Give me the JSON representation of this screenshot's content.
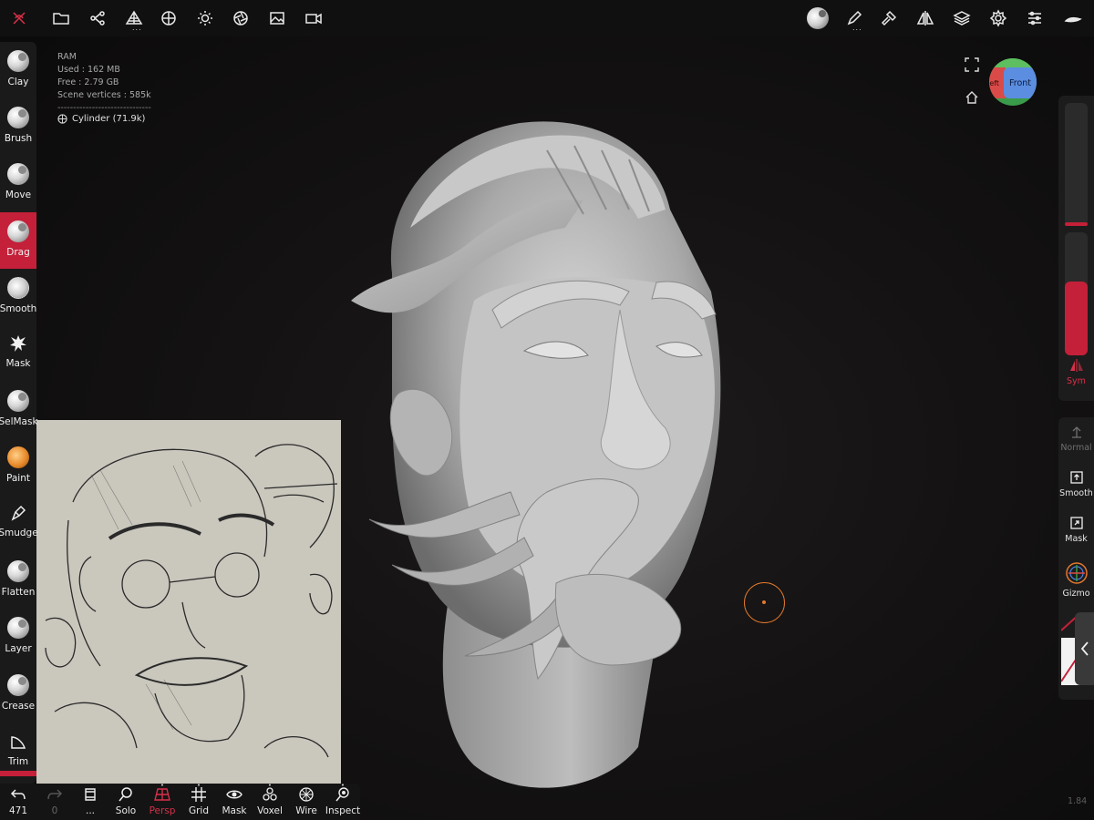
{
  "stats": {
    "ram_label": "RAM",
    "used": "Used : 162 MB",
    "free": "Free : 2.79 GB",
    "vertices": "Scene vertices : 585k",
    "separator": "------------------------------",
    "mesh": "Cylinder (71.9k)"
  },
  "tools": [
    {
      "label": "Clay"
    },
    {
      "label": "Brush"
    },
    {
      "label": "Move"
    },
    {
      "label": "Drag"
    },
    {
      "label": "Smooth"
    },
    {
      "label": "Mask"
    },
    {
      "label": "SelMask"
    },
    {
      "label": "Paint"
    },
    {
      "label": "Smudge"
    },
    {
      "label": "Flatten"
    },
    {
      "label": "Layer"
    },
    {
      "label": "Crease"
    },
    {
      "label": "Trim"
    }
  ],
  "active_tool": "Drag",
  "bottom": {
    "undo_count": "471",
    "redo_count": "0",
    "dots": "...",
    "solo": "Solo",
    "persp": "Persp",
    "grid": "Grid",
    "mask": "Mask",
    "voxel": "Voxel",
    "wire": "Wire",
    "inspect": "Inspect"
  },
  "navcube": {
    "front": "Front",
    "left": "Left"
  },
  "right": {
    "sym": "Sym",
    "normal": "Normal",
    "smooth": "Smooth",
    "mask": "Mask",
    "gizmo": "Gizmo",
    "radius_level": 0.02,
    "intensity_level": 0.6
  },
  "version": "1.84",
  "colors": {
    "accent": "#c42039",
    "cursor": "#e2792e"
  }
}
